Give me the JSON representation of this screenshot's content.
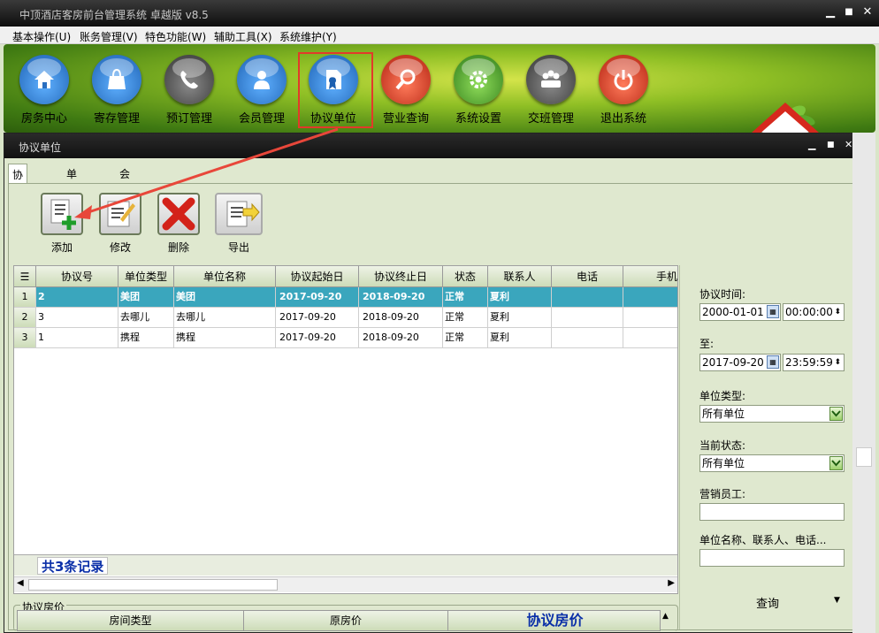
{
  "window": {
    "title": "中顶酒店客房前台管理系统 卓越版 v8.5",
    "min": "▁",
    "max": "■",
    "close": "✕"
  },
  "menu": [
    "基本操作(U)",
    "账务管理(V)",
    "特色功能(W)",
    "辅助工具(X)",
    "系统维护(Y)"
  ],
  "toolbar": [
    {
      "label": "房务中心",
      "icon": "home-icon",
      "color": "#2a7fc9"
    },
    {
      "label": "寄存管理",
      "icon": "bag-icon",
      "color": "#2a7fc9"
    },
    {
      "label": "预订管理",
      "icon": "phone-icon",
      "color": "#555555"
    },
    {
      "label": "会员管理",
      "icon": "person-icon",
      "color": "#2a7fc9"
    },
    {
      "label": "协议单位",
      "icon": "certificate-icon",
      "color": "#2a7fc9"
    },
    {
      "label": "营业查询",
      "icon": "magnifier-icon",
      "color": "#d83a28"
    },
    {
      "label": "系统设置",
      "icon": "gear-icon",
      "color": "#4aa335"
    },
    {
      "label": "交班管理",
      "icon": "group-icon",
      "color": "#555555"
    },
    {
      "label": "退出系统",
      "icon": "power-icon",
      "color": "#d83a28"
    }
  ],
  "sub": {
    "title": "协议单位",
    "tabs": [
      "协议单位",
      "单位类型",
      "会员房价"
    ],
    "actions": [
      "添加",
      "修改",
      "删除",
      "导出"
    ]
  },
  "grid": {
    "columns": [
      "协议号",
      "单位类型",
      "单位名称",
      "协议起始日",
      "协议终止日",
      "状态",
      "联系人",
      "电话",
      "手机"
    ],
    "rows": [
      {
        "n": "1",
        "c": [
          "2",
          "美团",
          "美团",
          "2017-09-20",
          "2018-09-20",
          "正常",
          "夏利",
          "",
          ""
        ]
      },
      {
        "n": "2",
        "c": [
          "3",
          "去哪儿",
          "去哪儿",
          "2017-09-20",
          "2018-09-20",
          "正常",
          "夏利",
          "",
          ""
        ]
      },
      {
        "n": "3",
        "c": [
          "1",
          "携程",
          "携程",
          "2017-09-20",
          "2018-09-20",
          "正常",
          "夏利",
          "",
          ""
        ]
      }
    ],
    "footer": "共3条记录"
  },
  "filters": {
    "time_label": "协议时间:",
    "from_date": "2000-01-01",
    "from_time": "00:00:00",
    "to_label": "至:",
    "to_date": "2017-09-20",
    "to_time": "23:59:59",
    "type_label": "单位类型:",
    "type_value": "所有单位",
    "status_label": "当前状态:",
    "status_value": "所有单位",
    "staff_label": "营销员工:",
    "staff_value": "",
    "search_label": "单位名称、联系人、电话...",
    "search_value": "",
    "query": "查询"
  },
  "price": {
    "title": "协议房价",
    "columns": [
      "房间类型",
      "原房价",
      "协议房价"
    ]
  }
}
